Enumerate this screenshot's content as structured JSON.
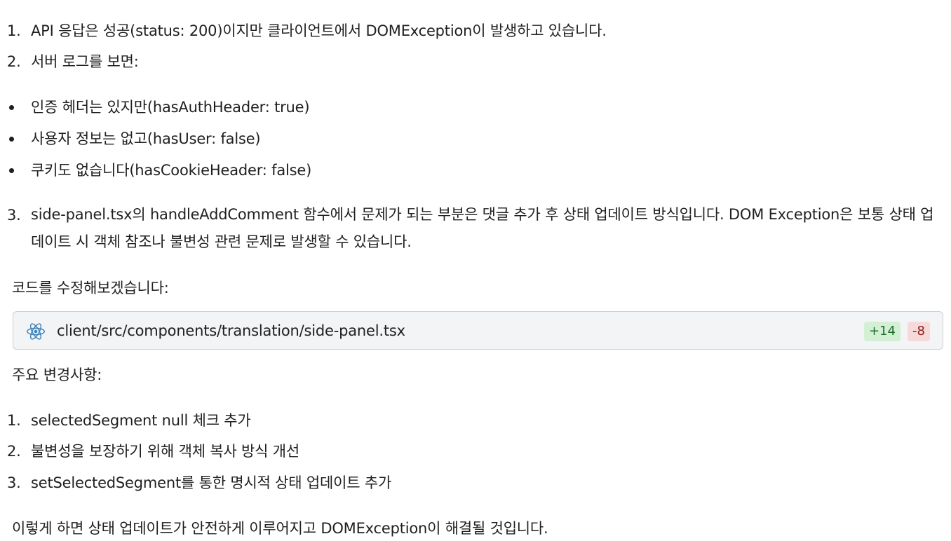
{
  "intro_list": [
    {
      "num": "1.",
      "text": "API 응답은 성공(status: 200)이지만 클라이언트에서 DOMException이 발생하고 있습니다."
    },
    {
      "num": "2.",
      "text": "서버 로그를 보면:"
    }
  ],
  "bullets": [
    "인증 헤더는 있지만(hasAuthHeader: true)",
    "사용자 정보는 없고(hasUser: false)",
    "쿠키도 없습니다(hasCookieHeader: false)"
  ],
  "item3": {
    "num": "3.",
    "text": "side-panel.tsx의 handleAddComment 함수에서 문제가 되는 부분은 댓글 추가 후 상태 업데이트 방식입니다. DOM Exception은 보통 상태 업데이트 시 객체 참조나 불변성 관련 문제로 발생할 수 있습니다."
  },
  "code_intro": "코드를 수정해보겠습니다:",
  "file_card": {
    "icon": "react-icon",
    "path": "client/src/components/translation/side-panel.tsx",
    "additions": "+14",
    "deletions": "-8"
  },
  "changes_title": "주요 변경사항:",
  "changes": [
    {
      "num": "1.",
      "text": "selectedSegment null 체크 추가"
    },
    {
      "num": "2.",
      "text": "불변성을 보장하기 위해 객체 복사 방식 개선"
    },
    {
      "num": "3.",
      "text": "setSelectedSegment를 통한 명시적 상태 업데이트 추가"
    }
  ],
  "conclusion": "이렇게 하면 상태 업데이트가 안전하게 이루어지고 DOMException이 해결될 것입니다."
}
